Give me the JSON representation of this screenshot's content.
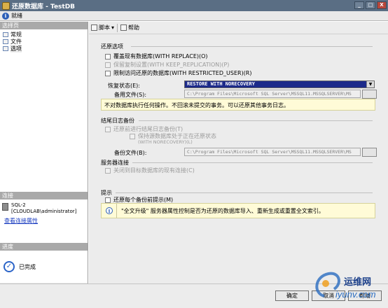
{
  "window": {
    "title": "还原数据库 - TestDB",
    "minimize": "_",
    "maximize": "□",
    "close": "X"
  },
  "status": {
    "icon": "info-icon",
    "text": "就绪"
  },
  "left": {
    "pages_header": "选择页",
    "pages": [
      {
        "label": "常规",
        "icon": "page-icon"
      },
      {
        "label": "文件",
        "icon": "page-icon"
      },
      {
        "label": "选项",
        "icon": "page-icon",
        "selected": true
      }
    ],
    "connection_header": "连接",
    "connection_server": "SQL-2",
    "connection_user": "[CLOUDLAB\\administrator]",
    "connection_link": "查看连接属性",
    "progress_header": "进度",
    "progress_text": "已完成"
  },
  "toolbar": {
    "script": "脚本",
    "script_arrow": "▾",
    "help": "帮助"
  },
  "restore_options": {
    "title": "还原选项",
    "overwrite": "覆盖现有数据库(WITH REPLACE)(O)",
    "keep_replication": "保留复制设置(WITH KEEP_REPLICATION)(P)",
    "restricted_user": "限制访问还原的数据库(WITH RESTRICTED_USER)(R)",
    "recovery_label": "恢复状态(E):",
    "recovery_value": "RESTORE WITH NORECOVERY",
    "standby_label": "备用文件(S):",
    "standby_value": "C:\\Program Files\\Microsoft SQL Server\\MSSQL11.MSSQLSERVER\\MS",
    "recovery_info": "不对数据库执行任何操作。不回滚未提交的事务。可以还原其他事务日志。"
  },
  "tail_log": {
    "title": "结尾日志备份",
    "take_tail": "还原前进行结尾日志备份(T)",
    "leave_restoring_1": "保持源数据库处于正在还原状态",
    "leave_restoring_2": "(WITH NORECOVERY)(L)",
    "backup_file_label": "备份文件(B):",
    "backup_file_value": "C:\\Program Files\\Microsoft SQL Server\\MSSQL11.MSSQLSERVER\\MS"
  },
  "server_connections": {
    "title": "服务器连接",
    "close_existing": "关闭到目标数据库的现有连接(C)"
  },
  "prompt": {
    "title": "提示",
    "prompt_before": "还原每个备份前提示(M)",
    "info": "\"全文升级\" 服务器属性控制是否为还原的数据库导入、重新生成或重置全文索引。"
  },
  "buttons": {
    "ok": "确定",
    "cancel": "取消",
    "help": "帮助"
  },
  "watermark": {
    "cn": "运维网",
    "en": "iyunv.com"
  }
}
